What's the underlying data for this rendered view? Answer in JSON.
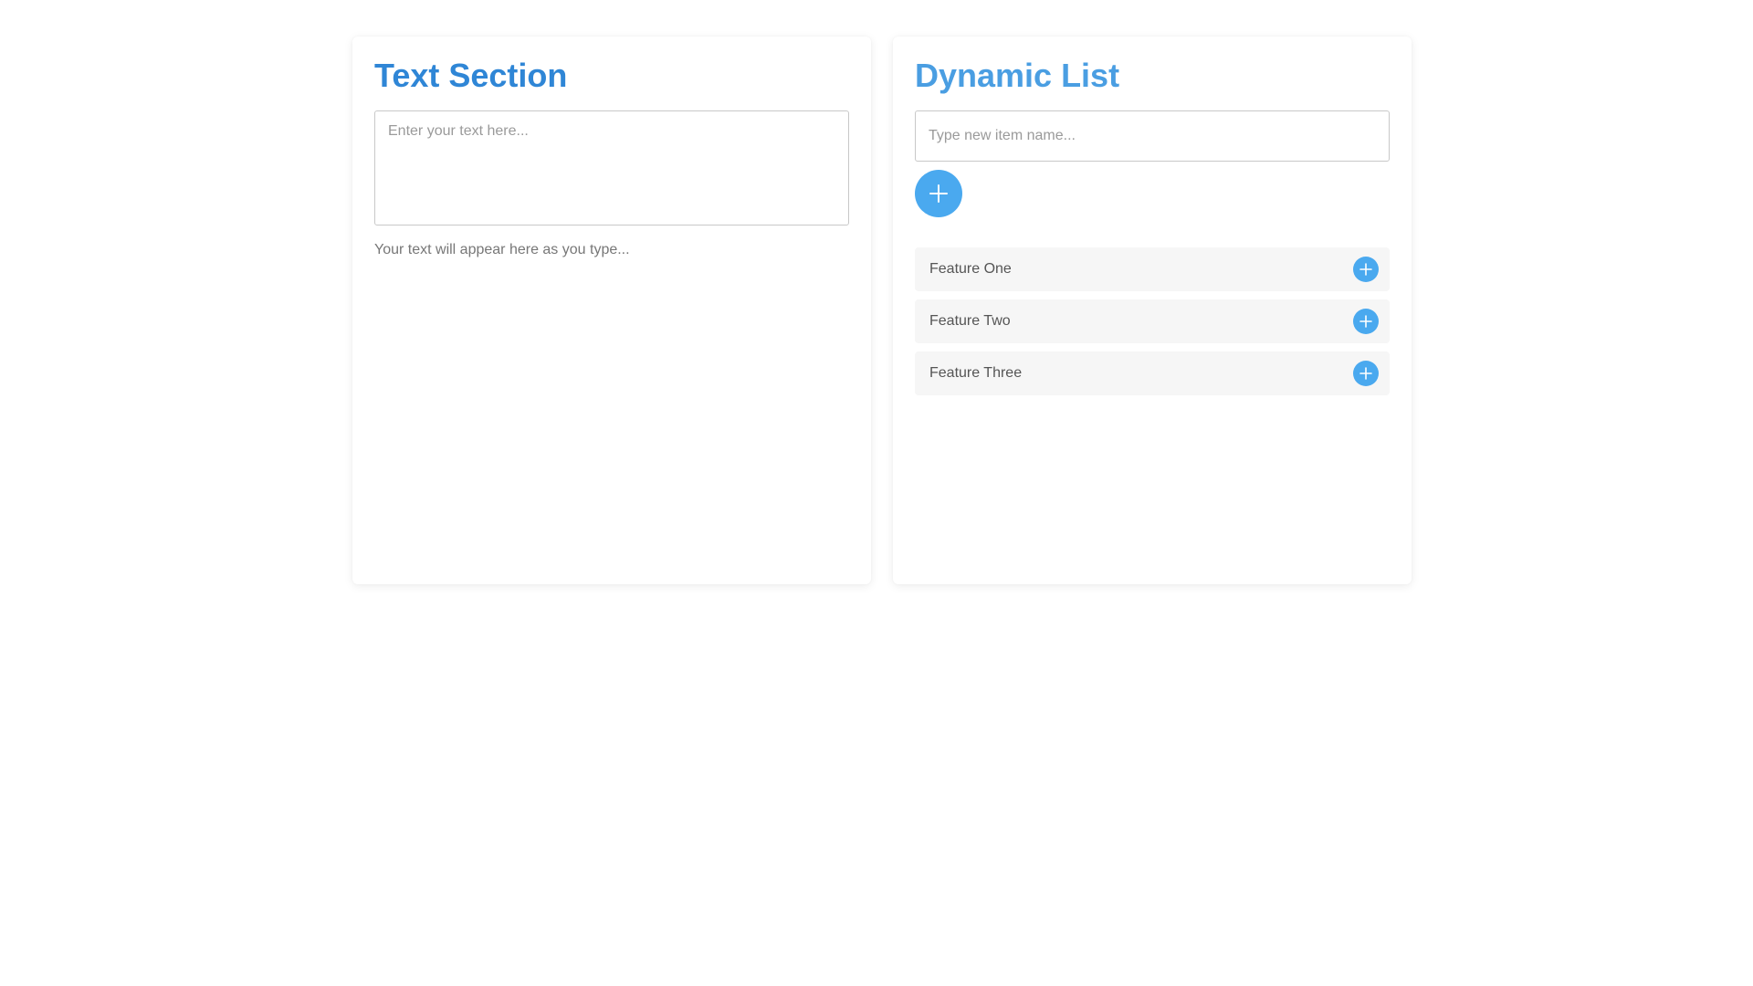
{
  "text_section": {
    "title": "Text Section",
    "textarea": {
      "value": "",
      "placeholder": "Enter your text here..."
    },
    "preview": "Your text will appear here as you type..."
  },
  "dynamic_list": {
    "title": "Dynamic List",
    "input": {
      "value": "",
      "placeholder": "Type new item name..."
    },
    "add_button_icon": "plus-icon",
    "items": [
      {
        "label": "Feature One",
        "icon": "plus-icon"
      },
      {
        "label": "Feature Two",
        "icon": "plus-icon"
      },
      {
        "label": "Feature Three",
        "icon": "plus-icon"
      }
    ]
  },
  "colors": {
    "title_text_section": "#2f86d6",
    "title_dynamic_list": "#4a9ee2",
    "accent_button": "#4aa9ef",
    "item_background": "#f6f6f6"
  }
}
